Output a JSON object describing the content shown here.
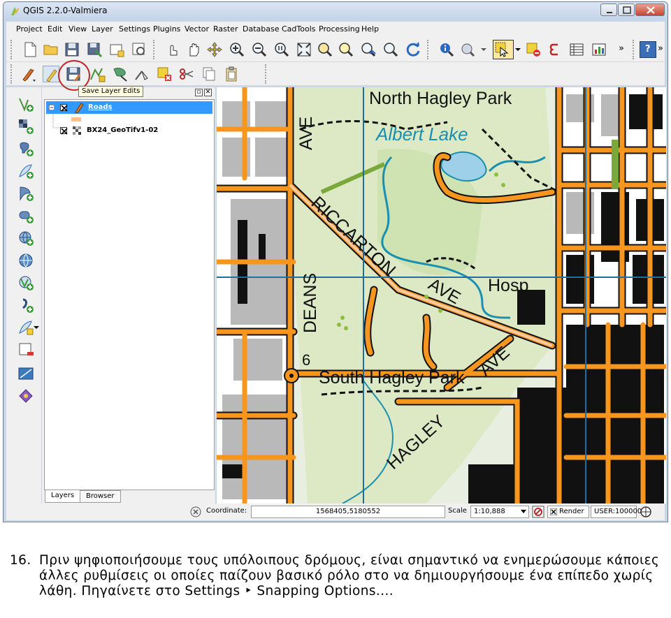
{
  "window": {
    "title": "QGIS 2.2.0-Valmiera",
    "controls": [
      "minimize-icon",
      "maximize-icon",
      "close-icon"
    ]
  },
  "menubar": {
    "items": [
      "Project",
      "Edit",
      "View",
      "Layer",
      "Settings",
      "Plugins",
      "Vector",
      "Raster",
      "Database",
      "CadTools",
      "Processing",
      "Help"
    ]
  },
  "toolbar": {
    "overflow_label": "»",
    "help_label": "?",
    "tooltip": "Save Layer Edits",
    "highlight_color": "#c0282a"
  },
  "layers_panel": {
    "layers": [
      {
        "name": "Roads",
        "checked": true,
        "selected": true
      },
      {
        "name": "BX24_GeoTifv1-02",
        "checked": true,
        "selected": false
      }
    ],
    "tabs": [
      "Layers",
      "Browser"
    ],
    "selection_color": "#3399ff"
  },
  "map": {
    "labels": [
      "North Hagley Park",
      "Albert Lake",
      "AVE",
      "RICCARTON",
      "AVE",
      "Hosp",
      "DEANS",
      "6",
      "South Hagley Park",
      "AVE",
      "HAGLEY"
    ],
    "colors": {
      "road": "#f7961e",
      "park": "#dce9c4",
      "water": "#1a8fb0",
      "building": "#000000",
      "grid": "#1e6fa0"
    }
  },
  "statusbar": {
    "coordinate_label": "Coordinate:",
    "coordinate_value": "1568405,5180552",
    "scale_label": "Scale",
    "scale_value": "1:10,888",
    "render_label": "Render",
    "crs_label": "USER:100000"
  },
  "caption": {
    "number": "16.",
    "text": "Πριν ψηφιοποιήσουμε τους υπόλοιπους δρόμους, είναι σημαντικό να ενημερώσουμε κάποιες άλλες ρυθμίσεις οι οποίες παίζουν βασικό ρόλο στο να δημιουργήσουμε ένα επίπεδο χωρίς λάθη. Πηγαίνετε στο Settings ‣ Snapping Options...."
  }
}
